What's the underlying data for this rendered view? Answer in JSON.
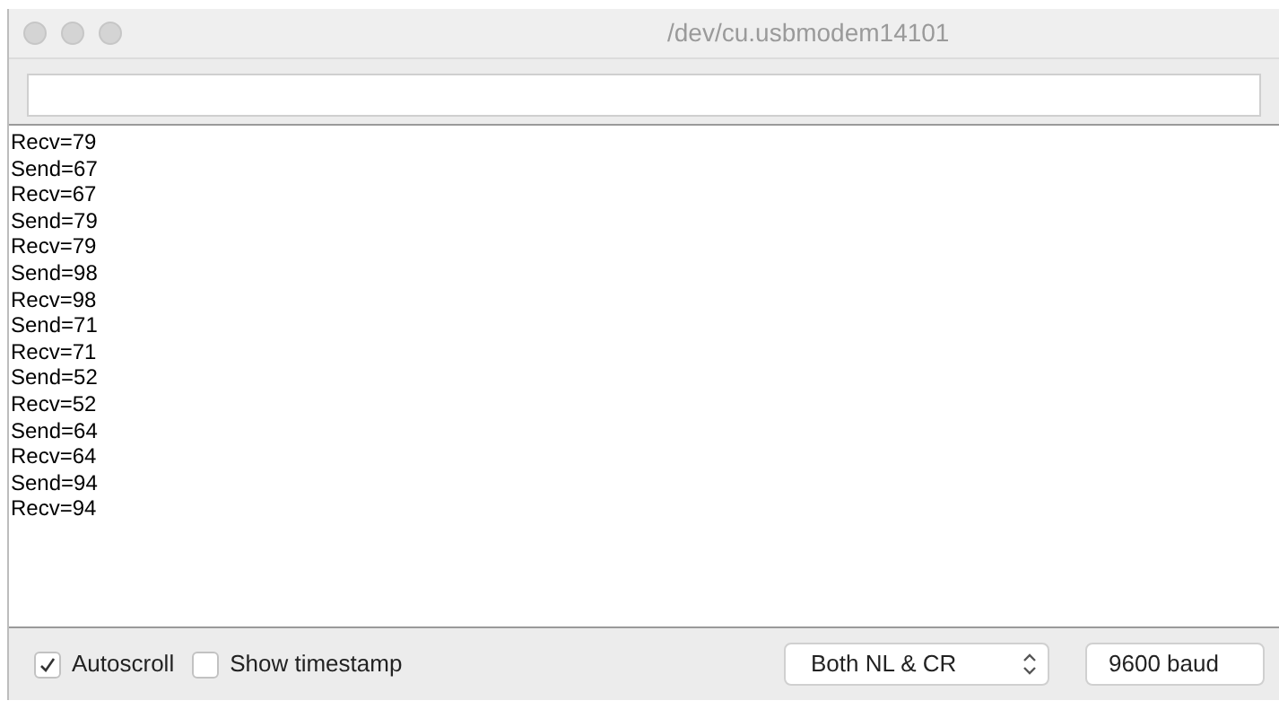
{
  "window": {
    "title": "/dev/cu.usbmodem14101"
  },
  "output": {
    "lines": [
      "Recv=79",
      "Send=67",
      "Recv=67",
      "Send=79",
      "Recv=79",
      "Send=98",
      "Recv=98",
      "Send=71",
      "Recv=71",
      "Send=52",
      "Recv=52",
      "Send=64",
      "Recv=64",
      "Send=94",
      "Recv=94"
    ]
  },
  "options": [
    {
      "label": "Autoscroll",
      "checked": true
    },
    {
      "label": "Show timestamp",
      "checked": false
    }
  ],
  "line_ending": {
    "value": "Both NL & CR"
  },
  "baud": {
    "value": "9600 baud"
  }
}
